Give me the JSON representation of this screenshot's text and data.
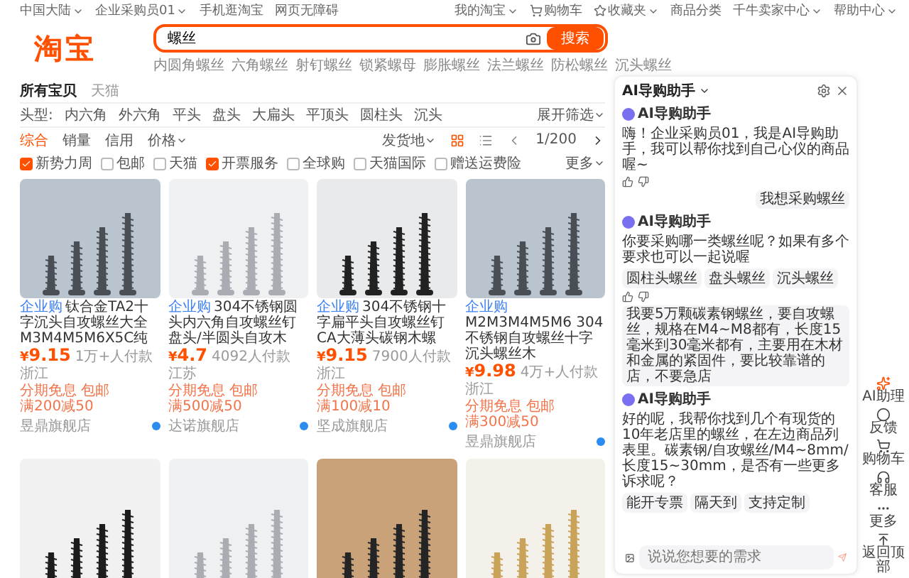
{
  "top_bar": {
    "left": [
      {
        "label": "中国大陆",
        "caret": true
      },
      {
        "label": "企业采购员01",
        "caret": true
      },
      {
        "label": "手机逛淘宝",
        "caret": false
      },
      {
        "label": "网页无障碍",
        "caret": false
      }
    ],
    "right": [
      {
        "label": "我的淘宝",
        "caret": true
      },
      {
        "label": "购物车",
        "caret": false
      },
      {
        "label": "收藏夹",
        "caret": true
      },
      {
        "label": "商品分类",
        "caret": false
      },
      {
        "label": "千牛卖家中心",
        "caret": true
      },
      {
        "label": "帮助中心",
        "caret": true
      }
    ]
  },
  "logo": "淘宝",
  "search": {
    "value": "螺丝",
    "button": "搜索",
    "suggestions": [
      "内圆角螺丝",
      "六角螺丝",
      "射钉螺丝",
      "锁紧螺母",
      "膨胀螺丝",
      "法兰螺丝",
      "防松螺丝",
      "沉头螺丝"
    ]
  },
  "tabs": [
    {
      "label": "所有宝贝",
      "selected": true
    },
    {
      "label": "天猫",
      "selected": false
    }
  ],
  "head_filter": {
    "label": "头型:",
    "options": [
      "内六角",
      "外六角",
      "平头",
      "盘头",
      "大扁头",
      "平顶头",
      "圆柱头",
      "沉头"
    ],
    "expand": "展开筛选"
  },
  "sort": {
    "options": [
      {
        "label": "综合",
        "selected": true,
        "caret": false
      },
      {
        "label": "销量",
        "selected": false,
        "caret": false
      },
      {
        "label": "信用",
        "selected": false,
        "caret": false
      },
      {
        "label": "价格",
        "selected": false,
        "caret": true
      }
    ],
    "location": "发货地",
    "views": [
      {
        "kind": "grid",
        "selected": true
      },
      {
        "kind": "list",
        "selected": false
      }
    ],
    "page": "1/200"
  },
  "checks": {
    "items": [
      {
        "label": "新势力周",
        "checked": true
      },
      {
        "label": "包邮",
        "checked": false
      },
      {
        "label": "天猫",
        "checked": false
      },
      {
        "label": "开票服务",
        "checked": true
      },
      {
        "label": "全球购",
        "checked": false
      },
      {
        "label": "天猫国际",
        "checked": false
      },
      {
        "label": "赠送运费险",
        "checked": false
      }
    ],
    "more": "更多"
  },
  "products": [
    {
      "kind": "dark",
      "badge": "企业购",
      "title": "钛合金TA2十字沉头自攻螺丝大全M3M4M5M6X5C纯",
      "currency": "¥",
      "price": "9.15",
      "sales": "1万+人付款",
      "region": "浙江",
      "tags": [
        "分期免息",
        "包邮",
        "满200减50"
      ],
      "shop": "昱鼎旗舰店"
    },
    {
      "kind": "silver",
      "badge": "企业购",
      "title": "304不锈钢圆头内六角自攻螺丝钉盘头/半圆头自攻木",
      "currency": "¥",
      "price": "4.7",
      "sales": "4092人付款",
      "region": "江苏",
      "tags": [
        "分期免息",
        "包邮",
        "满500减50"
      ],
      "shop": "达诺旗舰店"
    },
    {
      "kind": "mixed",
      "badge": "企业购",
      "title": "304不锈钢十字扁平头自攻螺丝钉CA大薄头碳钢木螺",
      "currency": "¥",
      "price": "9.15",
      "sales": "7900人付款",
      "region": "浙江",
      "tags": [
        "分期免息",
        "包邮",
        "满100减10"
      ],
      "shop": "坚成旗舰店"
    },
    {
      "kind": "dark",
      "badge": "企业购",
      "title": "M2M3M4M5M6 304不锈钢自攻螺丝十字沉头螺丝木",
      "currency": "¥",
      "price": "9.98",
      "sales": "4万+人付款",
      "region": "浙江",
      "tags": [
        "分期免息",
        "包邮",
        "满300减50"
      ],
      "shop": "昱鼎旗舰店"
    },
    {
      "kind": "black"
    },
    {
      "kind": "silver"
    },
    {
      "kind": "wood"
    },
    {
      "kind": "gold"
    }
  ],
  "assistant": {
    "title": "AI导购助手",
    "messages": [
      {
        "kind": "bot",
        "name": "AI导购助手",
        "text": "嗨！企业采购员01，我是AI导购助手，我可以帮你找到自己心仪的商品喔~",
        "feedback": true
      },
      {
        "kind": "user",
        "text": "我想采购螺丝"
      },
      {
        "kind": "bot",
        "name": "AI导购助手",
        "text": "你要采购哪一类螺丝呢？如果有多个要求也可以一起说喔",
        "chips": [
          "圆柱头螺丝",
          "盘头螺丝",
          "沉头螺丝"
        ],
        "feedback": true
      },
      {
        "kind": "user",
        "text": "我要5万颗碳素钢螺丝，要自攻螺丝，规格在M4~M8都有，长度15毫米到30毫米都有，主要用在木材和金属的紧固件，要比较靠谱的店，不要急店"
      },
      {
        "kind": "bot",
        "name": "AI导购助手",
        "text": "好的呢，我帮你找到几个有现货的10年老店里的螺丝，在左边商品列表里。碳素钢/自攻螺丝/M4~8mm/长度15~30mm，是否有一些更多诉求呢？",
        "chips": [
          "能开专票",
          "隔天到",
          "支持定制"
        ],
        "feedback": false
      }
    ],
    "input_placeholder": "说说您想要的需求"
  },
  "side_tools": [
    {
      "label": "AI助理"
    },
    {
      "label": "反馈"
    },
    {
      "label": "购物车"
    },
    {
      "label": "客服"
    },
    {
      "label": "更多"
    },
    {
      "label": "返回顶部"
    }
  ]
}
